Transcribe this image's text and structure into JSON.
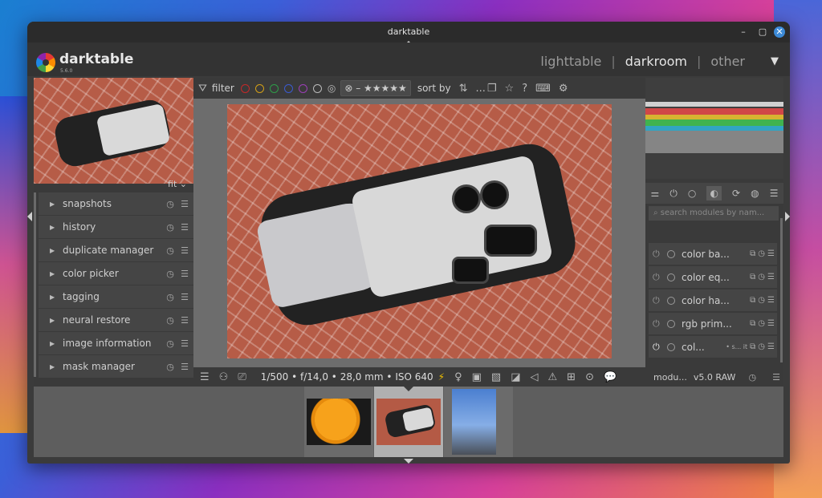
{
  "window": {
    "title": "darktable",
    "controls": [
      "–",
      "▢",
      "✕"
    ]
  },
  "header": {
    "app_name": "darktable",
    "version": "5.6.0",
    "views": [
      "lighttable",
      "darkroom",
      "other"
    ],
    "active_view": "darkroom"
  },
  "navigation": {
    "zoom": "fit"
  },
  "left_modules": [
    {
      "label": "snapshots"
    },
    {
      "label": "history"
    },
    {
      "label": "duplicate manager"
    },
    {
      "label": "color picker"
    },
    {
      "label": "tagging"
    },
    {
      "label": "neural restore"
    },
    {
      "label": "image information"
    },
    {
      "label": "mask manager"
    }
  ],
  "filterbar": {
    "filter_label": "filter",
    "color_labels": [
      "#c62828",
      "#d4a017",
      "#2e9d48",
      "#3a5bd0",
      "#9c3fb8"
    ],
    "rating": "⊗ – ★★★★★",
    "sort_label": "sort by",
    "more": "...",
    "buttons": [
      "☆",
      "?",
      "⌨",
      "⚙"
    ]
  },
  "image_info": {
    "exif": "1/500 • f/14,0 • 28,0 mm • ISO 640"
  },
  "right_panel": {
    "search_placeholder": "search modules by nam...",
    "modules": [
      {
        "name": "color ba..."
      },
      {
        "name": "color eq..."
      },
      {
        "name": "color ha..."
      },
      {
        "name": "rgb prim..."
      },
      {
        "name": "col...",
        "extra": "• s... it"
      }
    ],
    "footer_left": "modu...",
    "footer_right": "v5.0 RAW"
  },
  "filmstrip": {
    "selected_index": 1,
    "items": [
      "orange",
      "camera-bag",
      "flags"
    ]
  }
}
